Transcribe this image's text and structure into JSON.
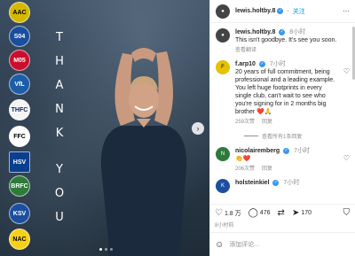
{
  "post": {
    "username": "lewis.holtby.8",
    "follow_label": "关注",
    "more_label": "···",
    "photo_text": [
      "T",
      "H",
      "A",
      "N",
      "K",
      "Y",
      "O",
      "U"
    ],
    "club_crests": [
      "AAC",
      "S04",
      "M05",
      "VfL",
      "THFC",
      "FFC",
      "HSV",
      "BRFC",
      "KSV",
      "NAC"
    ]
  },
  "caption": {
    "username": "lewis.holtby.8",
    "time": "8小时",
    "text": "This isn't goodbye. It's see you soon.",
    "translate": "查看翻译"
  },
  "comments": [
    {
      "username": "f.arp10",
      "time": "7小时",
      "text": "20 years of full commitment, being professional and a leading example. You left huge footprints in every single club, can't wait to see who you're signing for in 2 months big brother ❤️🙏",
      "likes": "259次赞",
      "reply": "回复",
      "view_replies": "查看所有1条回复"
    },
    {
      "username": "nicolairemberg",
      "time": "7小时",
      "text": "👏❤️",
      "likes": "206次赞",
      "reply": "回复"
    },
    {
      "username": "holsteinkiel",
      "time": "7小时",
      "text": ""
    }
  ],
  "actions": {
    "likes": "1.8 万",
    "comments": "476",
    "shares": "170"
  },
  "post_time": "8小时前",
  "add_comment_placeholder": "添加评论..."
}
